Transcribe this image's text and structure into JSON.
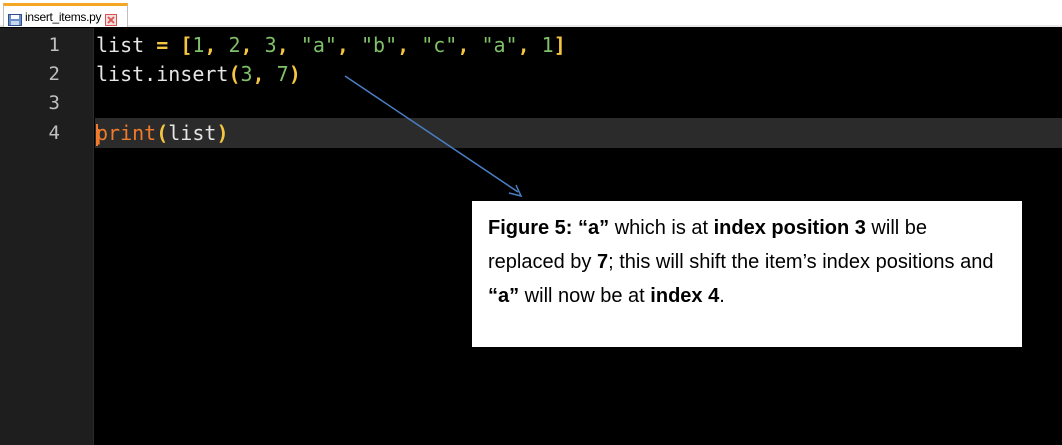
{
  "tab": {
    "filename": "insert_items.py",
    "icon": "save-file-icon",
    "close_icon": "close-icon",
    "close_color": "#d9534f"
  },
  "editor": {
    "line_numbers": [
      "1",
      "2",
      "3",
      "4"
    ],
    "colors": {
      "background": "#000000",
      "identifier": "#e6e6e6",
      "operator": "#f5c542",
      "literal": "#7fc06a",
      "keyword": "#f07b2c"
    },
    "line1": {
      "name": "list",
      "eq": "=",
      "open": "[",
      "items": [
        "1",
        "2",
        "3",
        "\"a\"",
        "\"b\"",
        "\"c\"",
        "\"a\"",
        "1"
      ],
      "close": "]"
    },
    "line2": {
      "obj": "list.insert",
      "open": "(",
      "arg1": "3",
      "arg2": "7",
      "close": ")"
    },
    "line4": {
      "func": "print",
      "open": "(",
      "arg": "list",
      "close": ")"
    }
  },
  "callout": {
    "p1": "Figure 5: ",
    "p2": "“a”",
    "p3": " which is at ",
    "p4": "index position 3",
    "p5": " will be replaced by ",
    "p6": "7",
    "p7": "; this will shift the item’s index positions and ",
    "p8": "“a”",
    "p9": " will now be at ",
    "p10": "index 4",
    "p11": "."
  }
}
